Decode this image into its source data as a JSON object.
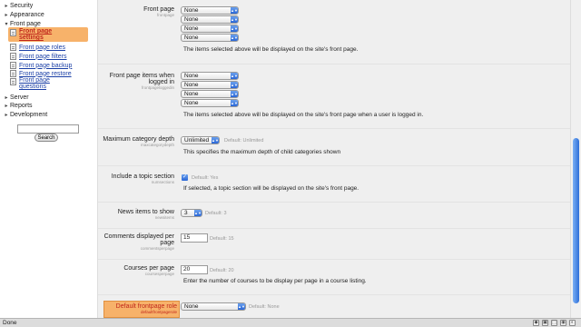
{
  "sidebar": {
    "items": [
      {
        "label": "Security",
        "expander": "▸"
      },
      {
        "label": "Appearance",
        "expander": "▸"
      },
      {
        "label": "Front page",
        "expander": "▾"
      }
    ],
    "front_page_children": [
      "Front page settings",
      "Front page roles",
      "Front page filters",
      "Front page backup",
      "Front page restore",
      "Front page questions"
    ],
    "after_items": [
      {
        "label": "Server",
        "expander": "▸"
      },
      {
        "label": "Reports",
        "expander": "▸"
      },
      {
        "label": "Development",
        "expander": "▸"
      }
    ],
    "search_value": "",
    "search_button": "Search"
  },
  "settings": {
    "front_page": {
      "label": "Front page",
      "name": "frontpage",
      "selects": [
        "None",
        "None",
        "None",
        "None"
      ],
      "description": "The items selected above will be displayed on the site's front page."
    },
    "front_page_logged_in": {
      "label_line1": "Front page items when",
      "label_line2": "logged in",
      "name": "frontpageloggedin",
      "selects": [
        "None",
        "None",
        "None",
        "None"
      ],
      "description": "The items selected above will be displayed on the site's front page when a user is logged in."
    },
    "max_category_depth": {
      "label": "Maximum category depth",
      "name": "maxcategorydepth",
      "value": "Unlimited",
      "default": "Default: Unlimited",
      "description": "This specifies the maximum depth of child categories shown"
    },
    "include_topic_section": {
      "label": "Include a topic section",
      "name": "numsections",
      "checked": true,
      "default": "Default: Yes",
      "description": "If selected, a topic section will be displayed on the site's front page."
    },
    "news_items": {
      "label": "News items to show",
      "name": "newsitems",
      "value": "3",
      "default": "Default: 3"
    },
    "comments_per_page": {
      "label_line1": "Comments displayed per",
      "label_line2": "page",
      "name": "commentsperpage",
      "value": "15",
      "default": "Default: 15"
    },
    "courses_per_page": {
      "label": "Courses per page",
      "name": "coursesperpage",
      "value": "20",
      "default": "Default: 20",
      "description": "Enter the number of courses to be display per page in a course listing."
    },
    "default_frontpage_role": {
      "label": "Default frontpage role",
      "name": "defaultfrontpagerole",
      "value": "None",
      "default": "Default: None"
    }
  },
  "statusbar": {
    "text": "Done"
  },
  "colors": {
    "highlight": "#f7b26a",
    "accent_blue": "#2a67d6",
    "link": "#1a3fa6",
    "active_link": "#c0261b"
  },
  "icons": [
    "page-icon",
    "chevron-down-icon",
    "checkmark-icon",
    "triangle-right-icon",
    "triangle-down-icon"
  ]
}
